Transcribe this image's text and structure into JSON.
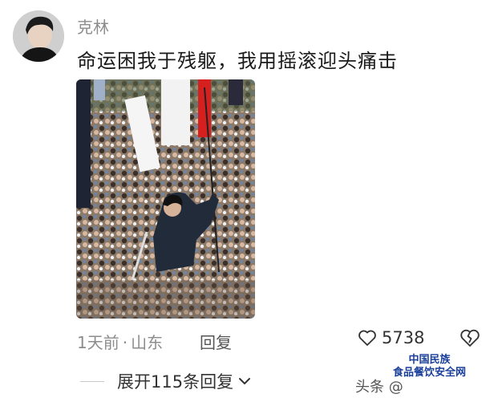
{
  "comment": {
    "username": "克林",
    "text": "命运困我于残躯，我用摇滚迎头痛击",
    "time": "1天前",
    "location": "山东",
    "separator": "·",
    "reply_label": "回复",
    "likes": "5738",
    "expand_label": "展开115条回复"
  },
  "watermark": {
    "text": "头条 @",
    "logo_line1": "中国民族",
    "logo_line2": "食品餐饮安全网"
  },
  "colors": {
    "meta": "#8c8c8c",
    "text": "#1a1a1a"
  }
}
